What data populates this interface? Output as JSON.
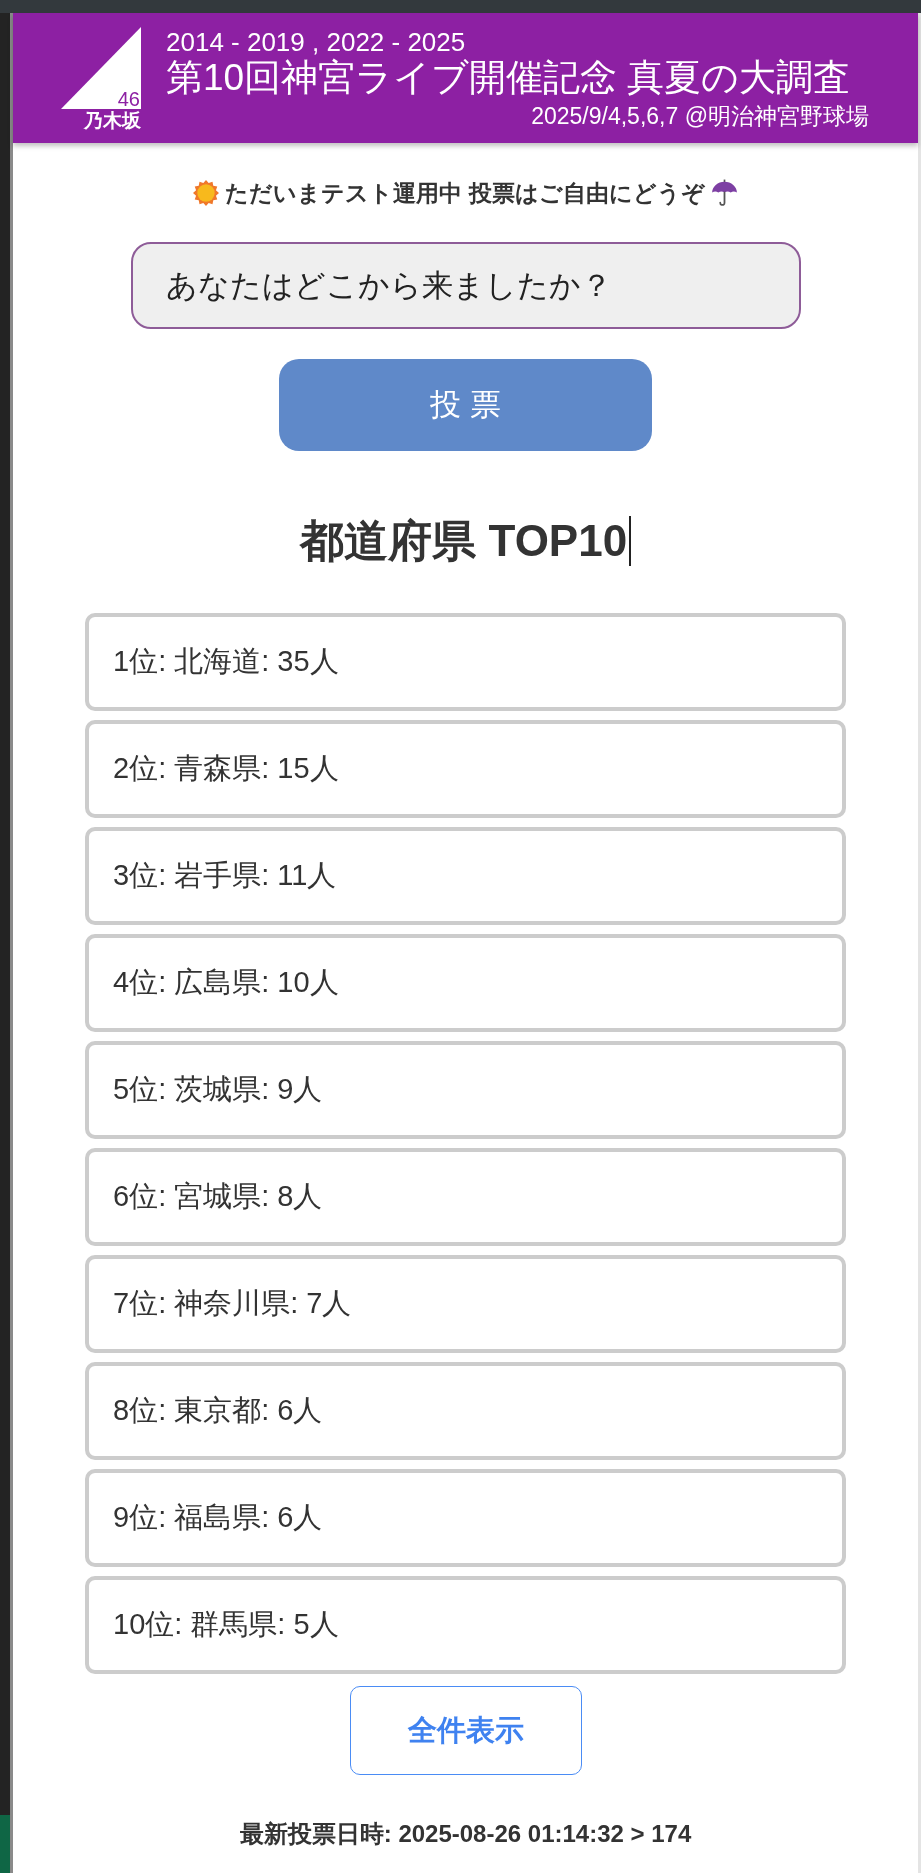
{
  "header": {
    "logo": {
      "number": "46",
      "name": "乃木坂"
    },
    "years": "2014 - 2019 , 2022 - 2025",
    "title": "第10回神宮ライブ開催記念 真夏の大調査",
    "date_venue": "2025/9/4,5,6,7 @明治神宮野球場"
  },
  "notice": "ただいまテスト運用中 投票はご自由にどうぞ",
  "origin_field": {
    "value": "あなたはどこから来ましたか？"
  },
  "vote_button": "投 票",
  "ranking": {
    "title": "都道府県 TOP10",
    "items": [
      {
        "text": "1位: 北海道: 35人"
      },
      {
        "text": "2位: 青森県: 15人"
      },
      {
        "text": "3位: 岩手県: 11人"
      },
      {
        "text": "4位: 広島県: 10人"
      },
      {
        "text": "5位: 茨城県: 9人"
      },
      {
        "text": "6位: 宮城県: 8人"
      },
      {
        "text": "7位: 神奈川県: 7人"
      },
      {
        "text": "8位: 東京都: 6人"
      },
      {
        "text": "9位: 福島県: 6人"
      },
      {
        "text": "10位: 群馬県: 5人"
      }
    ]
  },
  "show_all_button": "全件表示",
  "footer": "最新投票日時: 2025-08-26 01:14:32 > 174"
}
